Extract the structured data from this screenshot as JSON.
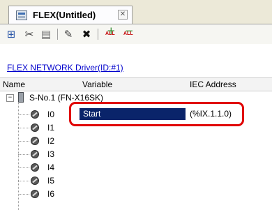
{
  "tab": {
    "title": "FLEX(Untitled)",
    "close": "✕"
  },
  "toolbar": {
    "buttons": [
      {
        "name": "add-station",
        "glyph": "⊞"
      },
      {
        "name": "cut",
        "glyph": "✂"
      },
      {
        "name": "paste",
        "glyph": "▤"
      },
      {
        "name": "properties",
        "glyph": "✎"
      },
      {
        "name": "delete",
        "glyph": "✖"
      },
      {
        "name": "add-all",
        "glyph": "+",
        "sub": "ALL"
      },
      {
        "name": "remove-all",
        "glyph": "−",
        "sub": "ALL"
      }
    ]
  },
  "driver_link": "FLEX NETWORK Driver(ID:#1)",
  "columns": {
    "name": "Name",
    "variable": "Variable",
    "iec": "IEC Address"
  },
  "station": {
    "expander": "−",
    "label": "S-No.1 (FN-X16SK)"
  },
  "io_items": [
    "I0",
    "I1",
    "I2",
    "I3",
    "I4",
    "I5",
    "I6"
  ],
  "selected": {
    "variable": "Start",
    "iec_address": "(%IX.1.1.0)"
  },
  "colors": {
    "highlight": "#0a246a",
    "annotation": "#e00000",
    "link": "#0000cc"
  }
}
